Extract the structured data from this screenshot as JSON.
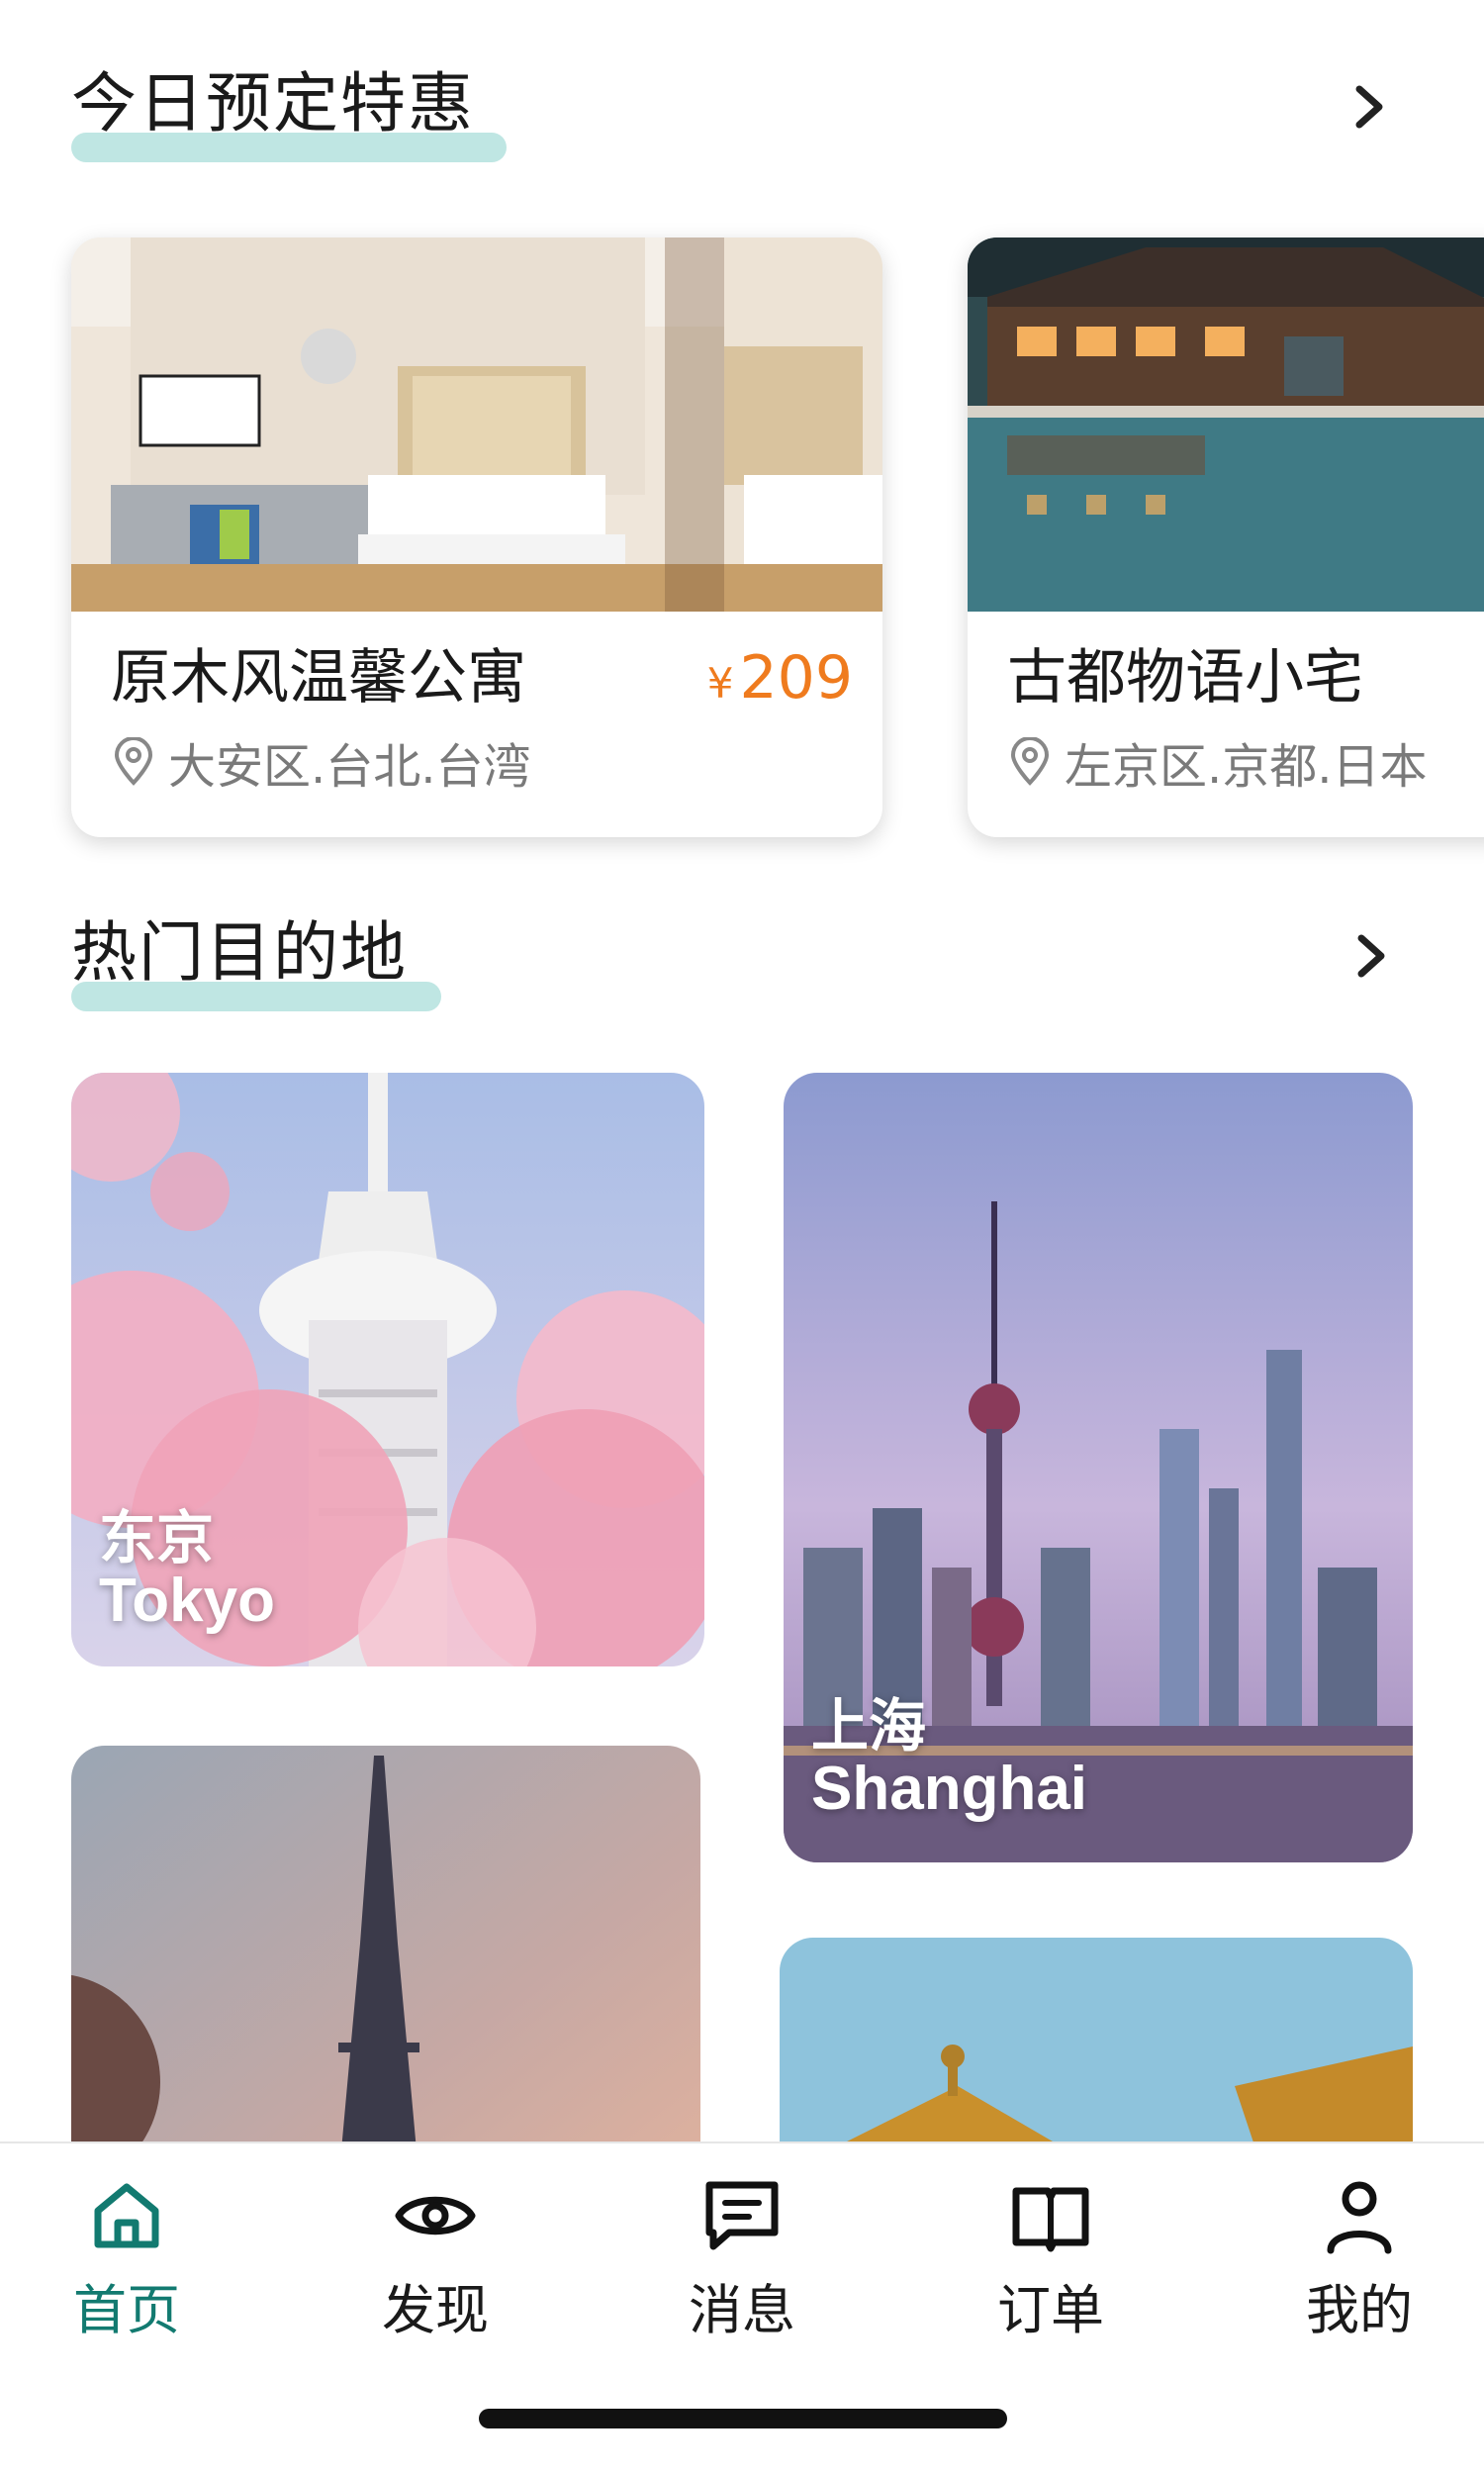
{
  "sections": {
    "deals_title": "今日预定特惠",
    "destinations_title": "热门目的地"
  },
  "deals": [
    {
      "name": "原木风温馨公寓",
      "price_symbol": "¥",
      "price": "209",
      "location": "大安区.台北.台湾"
    },
    {
      "name": "古都物语小宅",
      "location": "左京区.京都.日本"
    }
  ],
  "destinations": [
    {
      "cn": "东京",
      "en": "Tokyo"
    },
    {
      "cn": "上海",
      "en": "Shanghai"
    },
    {
      "cn": "",
      "en": ""
    },
    {
      "cn": "",
      "en": ""
    }
  ],
  "tabbar": {
    "tabs": [
      {
        "label": "首页",
        "icon": "home-icon",
        "active": true
      },
      {
        "label": "发现",
        "icon": "eye-icon",
        "active": false
      },
      {
        "label": "消息",
        "icon": "message-icon",
        "active": false
      },
      {
        "label": "订单",
        "icon": "book-icon",
        "active": false
      },
      {
        "label": "我的",
        "icon": "person-icon",
        "active": false
      }
    ]
  },
  "colors": {
    "accent": "#127a70",
    "highlight": "#bfe6e3",
    "price": "#ef7b1e"
  }
}
